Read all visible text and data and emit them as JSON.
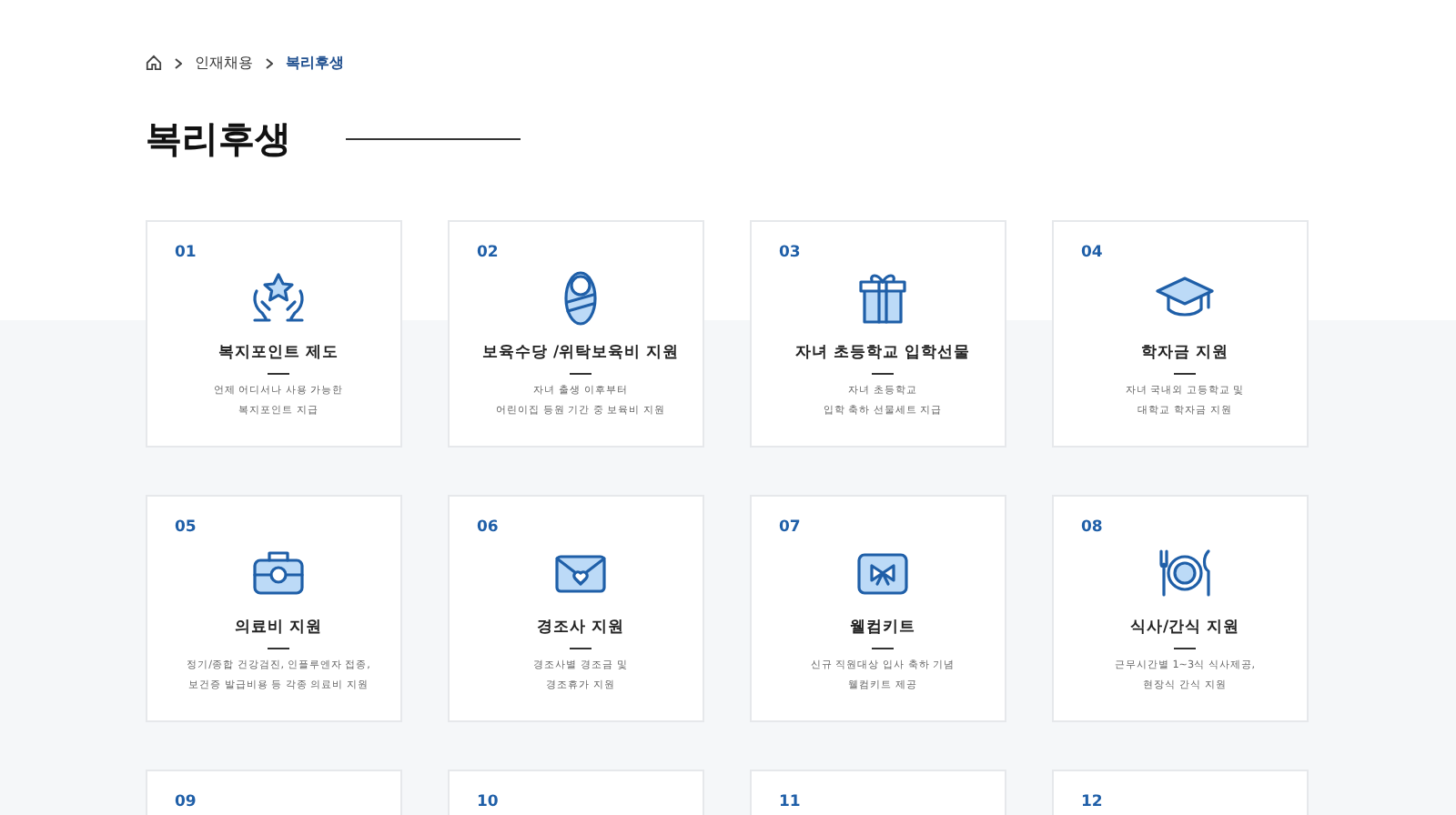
{
  "breadcrumb": {
    "items": [
      {
        "label": "인재채용",
        "selected": false
      },
      {
        "label": "복리후생",
        "selected": true
      }
    ]
  },
  "title": "복리후생",
  "cards": [
    {
      "number": "01",
      "title": "복지포인트 제도",
      "description": [
        "언제 어디서나 사용 가능한",
        "복지포인트 지급"
      ]
    },
    {
      "number": "02",
      "title": "보육수당 /위탁보육비 지원",
      "description": [
        "자녀 출생 이후부터",
        "어린이집 등원 기간 중 보육비 지원"
      ]
    },
    {
      "number": "03",
      "title": "자녀 초등학교 입학선물",
      "description": [
        "자녀 초등학교",
        "입학 축하 선물세트 지급"
      ]
    },
    {
      "number": "04",
      "title": "학자금 지원",
      "description": [
        "자녀 국내외 고등학교 및",
        "대학교 학자금 지원"
      ]
    },
    {
      "number": "05",
      "title": "의료비 지원",
      "description": [
        "정기/종합 건강검진, 인플루엔자 접종,",
        "보건증 발급비용 등 각종 의료비 지원"
      ]
    },
    {
      "number": "06",
      "title": "경조사 지원",
      "description": [
        "경조사별 경조금 및",
        "경조휴가 지원"
      ]
    },
    {
      "number": "07",
      "title": "웰컴키트",
      "description": [
        "신규 직원대상 입사 축하 기념",
        "웰컴키트 제공"
      ]
    },
    {
      "number": "08",
      "title": "식사/간식 지원",
      "description": [
        "근무시간별 1~3식 식사제공,",
        "현장식 간식 지원"
      ]
    },
    {
      "number": "09"
    },
    {
      "number": "10"
    },
    {
      "number": "11"
    },
    {
      "number": "12"
    }
  ]
}
